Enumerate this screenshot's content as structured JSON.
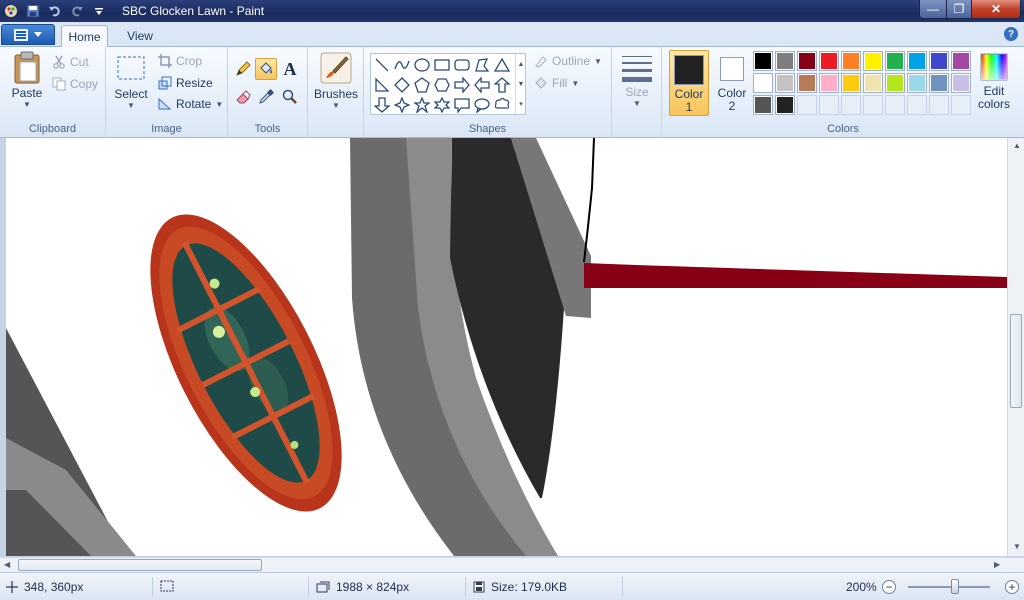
{
  "window": {
    "title": "SBC Glocken Lawn - Paint",
    "controls": {
      "minimize": "—",
      "maximize": "❐",
      "close": "✕"
    }
  },
  "tabs": [
    {
      "label": "Home",
      "active": true
    },
    {
      "label": "View",
      "active": false
    }
  ],
  "help": "?",
  "ribbon": {
    "clipboard": {
      "group_label": "Clipboard",
      "paste": "Paste",
      "cut": "Cut",
      "copy": "Copy"
    },
    "image": {
      "group_label": "Image",
      "select": "Select",
      "crop": "Crop",
      "resize": "Resize",
      "rotate": "Rotate"
    },
    "tools": {
      "group_label": "Tools",
      "text_glyph": "A",
      "active_tool": "fill-tool"
    },
    "brushes": {
      "label": "Brushes"
    },
    "shapes": {
      "group_label": "Shapes",
      "outline": "Outline",
      "fill": "Fill"
    },
    "size": {
      "label": "Size"
    },
    "colors": {
      "group_label": "Colors",
      "color1_label": "Color",
      "color1_num": "1",
      "color2_label": "Color",
      "color2_num": "2",
      "color1_value": "#222222",
      "color2_value": "#ffffff",
      "edit_colors_line1": "Edit",
      "edit_colors_line2": "colors",
      "palette": [
        "#000000",
        "#7f7f7f",
        "#880015",
        "#ed1c24",
        "#ff7f27",
        "#fff200",
        "#22b14c",
        "#00a2e8",
        "#3f48cc",
        "#a349a4",
        "#ffffff",
        "#c3c3c3",
        "#b97a57",
        "#ffaec9",
        "#ffc90e",
        "#efe4b0",
        "#b5e61d",
        "#99d9ea",
        "#7092be",
        "#c8bfe7",
        "#555555",
        "#222222",
        "",
        "",
        "",
        "",
        "",
        "",
        "",
        ""
      ]
    }
  },
  "status": {
    "cursor_position": "348, 360px",
    "image_dimensions": "1988 × 824px",
    "file_size": "Size: 179.0KB",
    "zoom": "200%"
  }
}
